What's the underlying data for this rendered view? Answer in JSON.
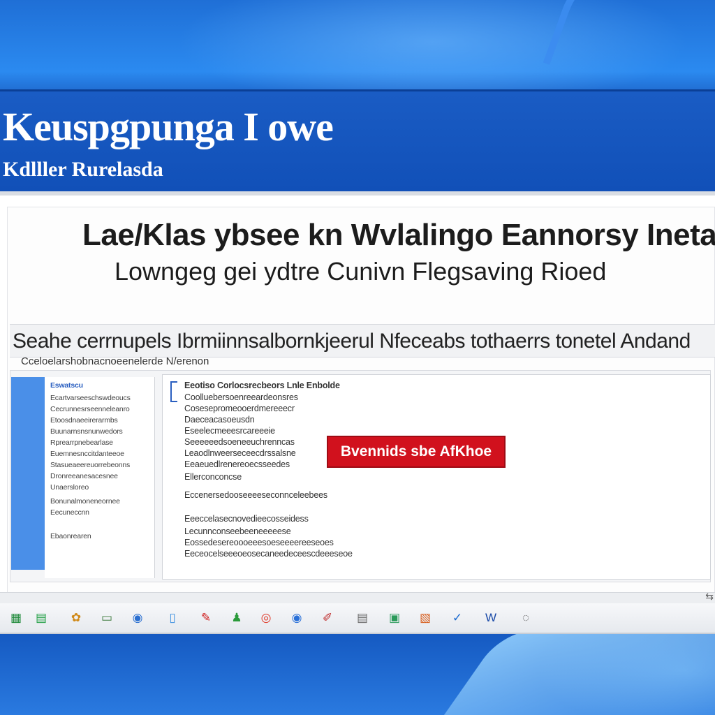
{
  "window": {
    "title": "Keuspgpunga I owe",
    "subtitle": "Kdlller Rurelasda"
  },
  "main": {
    "headline": "Lae/Klas ybsee kn Wvlalingo Eannorsy Inetar",
    "subheadline": "Lowngeg gei ydtre Cunivn Flegsaving Rioed",
    "banner_text": "Seahe cerrnupels Ibrmiinnsalbornkjeerul Nfeceabs tothaerrs tonetel Andand",
    "banner_sub": "Cceloelarshobnacnoeenelerde N/erenon"
  },
  "sidebar": {
    "items": [
      {
        "label": "Eswatscu",
        "heading": true
      },
      {
        "label": "Ecartvarseeschswdeoucs"
      },
      {
        "label": "Cecrunnesrseenneleanro"
      },
      {
        "label": "Etoosdnaeeirerarmbs"
      },
      {
        "label": "Buunarnsnsnunwedors"
      },
      {
        "label": "Rprearrpnebearlase"
      },
      {
        "label": "Euemnesnccitdanteeoe"
      },
      {
        "label": "Stasueaeereuorrebeonns"
      },
      {
        "label": "Dronreeanesacesnee"
      },
      {
        "label": "Unaersloreo"
      },
      {
        "label": "Bonunalmoneneornee"
      },
      {
        "label": "Eecuneccnn"
      },
      {
        "label": "Ebaonrearen"
      }
    ]
  },
  "document": {
    "lines": [
      "Eeotiso Corlocsrecbeors Lnle Enbolde",
      "Coolluebersoenreeardeonsres",
      "Cosesepromeooerdmereeecr",
      "Daeceacasoeusdn",
      "Eseelecmeeesrcareeeie",
      "Seeeeeedsoeneeuchrenncas",
      "Leaodlnweerseceecdrssalsne",
      "Eeaeuedlrenereoecsseedes",
      "Ellerconconcse",
      "Eccenersedooseeeeseconnceleebees",
      "Eeeccelasecnovedieecosseidess",
      "Lecunnconseebeeneeeeese",
      "Eossedesereoooeeesoeseeeereeseoes",
      "Eeceocelseeeoeosecaneedeceescdeeeseoe"
    ],
    "action_button": "Bvennids sbe AfKhoe"
  },
  "taskbar": {
    "icons": [
      {
        "name": "sheet-icon",
        "glyph": "▦",
        "color": "#1f8a3a"
      },
      {
        "name": "spreadsheet-icon",
        "glyph": "▤",
        "color": "#23a046"
      },
      {
        "name": "gallery-icon",
        "glyph": "✿",
        "color": "#d08a1a"
      },
      {
        "name": "monitor-icon",
        "glyph": "▭",
        "color": "#3c7a3c"
      },
      {
        "name": "globe-icon",
        "glyph": "◉",
        "color": "#2a6fd0"
      },
      {
        "name": "document-icon",
        "glyph": "▯",
        "color": "#3b8fe0"
      },
      {
        "name": "paint-icon",
        "glyph": "✎",
        "color": "#d02020"
      },
      {
        "name": "people-icon",
        "glyph": "♟",
        "color": "#2a9a3a"
      },
      {
        "name": "chrome-icon",
        "glyph": "◎",
        "color": "#e03a2a"
      },
      {
        "name": "browser-icon",
        "glyph": "◉",
        "color": "#2a70d8"
      },
      {
        "name": "pencil-icon",
        "glyph": "✐",
        "color": "#c03030"
      },
      {
        "name": "notes-icon",
        "glyph": "▤",
        "color": "#6a6a6a"
      },
      {
        "name": "calendar-icon",
        "glyph": "▣",
        "color": "#2a9a5a"
      },
      {
        "name": "photo-icon",
        "glyph": "▧",
        "color": "#d86020"
      },
      {
        "name": "check-icon",
        "glyph": "✓",
        "color": "#1a6ad0"
      },
      {
        "name": "word-icon",
        "glyph": "W",
        "color": "#1a4aa8"
      },
      {
        "name": "search-icon",
        "glyph": "◌",
        "color": "#555555"
      }
    ]
  },
  "corner_glyph": "⇆",
  "colors": {
    "desktop_blue": "#1150b8",
    "action_red": "#d1111d",
    "accent_blue": "#4a8fe8"
  }
}
